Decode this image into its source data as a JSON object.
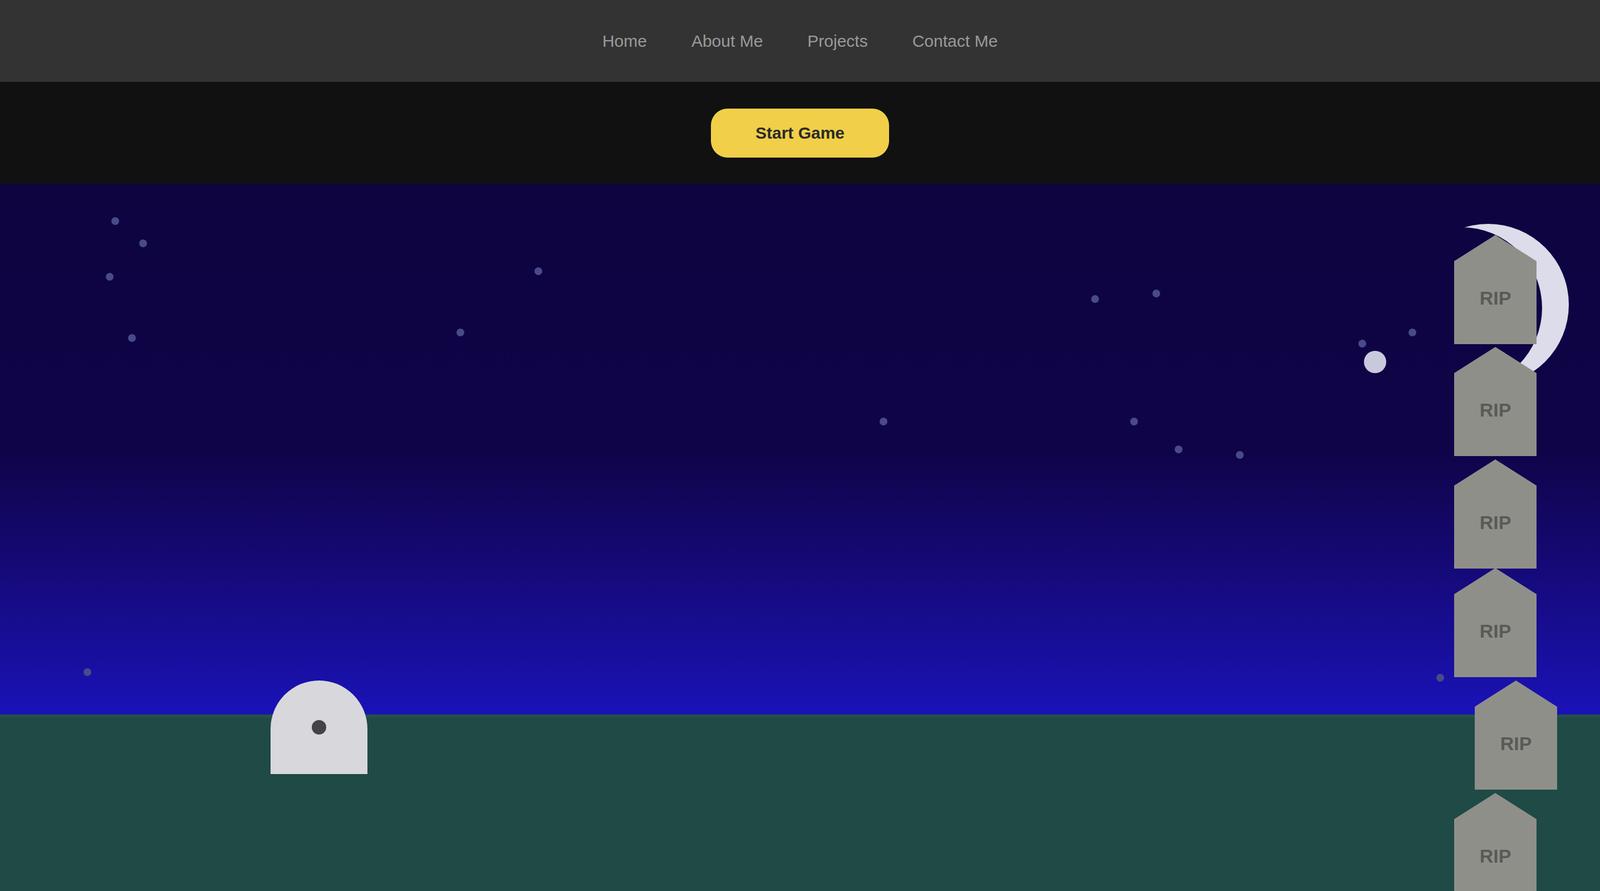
{
  "nav": {
    "links": [
      {
        "label": "Home"
      },
      {
        "label": "About Me"
      },
      {
        "label": "Projects"
      },
      {
        "label": "Contact Me"
      }
    ]
  },
  "toolbar": {
    "button": "Start Game"
  },
  "game": {
    "tombstones": [
      {
        "label": "RIP"
      },
      {
        "label": "RIP"
      },
      {
        "label": "RIP"
      },
      {
        "label": "RIP"
      },
      {
        "label": "RIP"
      },
      {
        "label": "RIP"
      }
    ]
  }
}
